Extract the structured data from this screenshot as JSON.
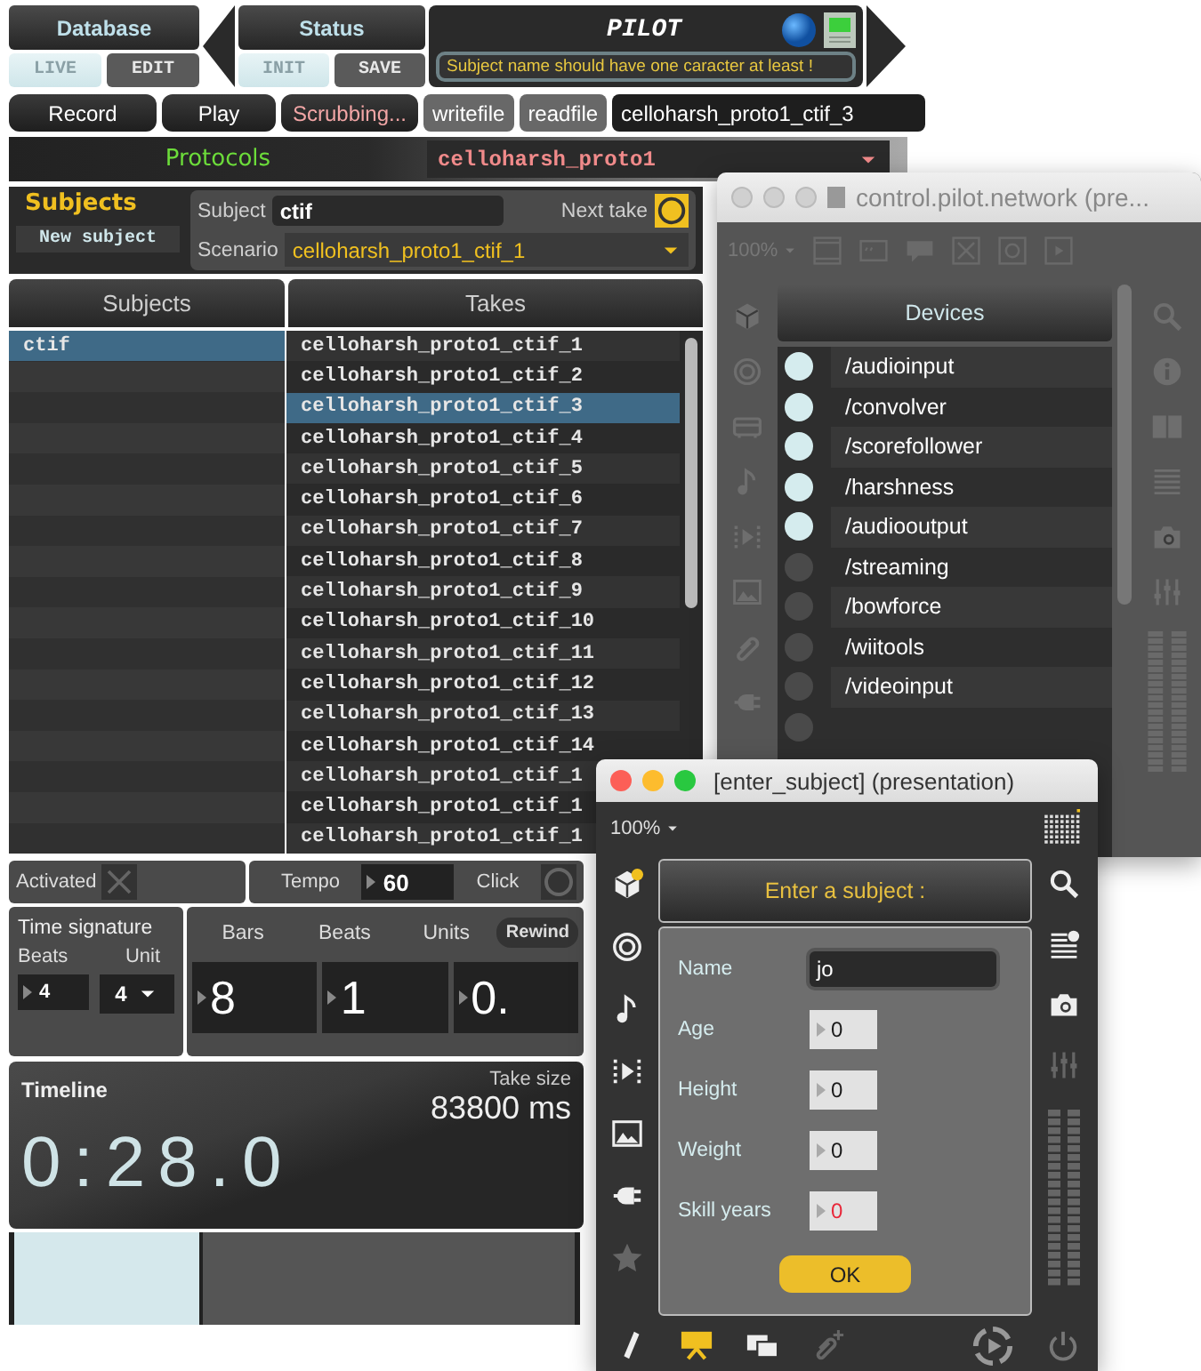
{
  "database": {
    "title": "Database",
    "buttons": [
      {
        "label": "LIVE",
        "selected": true
      },
      {
        "label": "EDIT",
        "selected": false
      }
    ]
  },
  "status": {
    "title": "Status",
    "buttons": [
      {
        "label": "INIT",
        "selected": true
      },
      {
        "label": "SAVE",
        "selected": false
      }
    ]
  },
  "pilot": {
    "title": "PILOT",
    "message": "Subject name should have one caracter at least !"
  },
  "transport": [
    {
      "label": "Record",
      "active": false
    },
    {
      "label": "Play",
      "active": false
    },
    {
      "label": "Scrubbing...",
      "active": true
    }
  ],
  "file": {
    "write": "writefile",
    "read": "readfile",
    "value": "celloharsh_proto1_ctif_3"
  },
  "protocols": {
    "label": "Protocols",
    "value": "celloharsh_proto1"
  },
  "subject_form": {
    "title": "Subjects",
    "new_button": "New subject",
    "subject_label": "Subject",
    "subject_value": "ctif",
    "next_take": "Next take",
    "scenario_label": "Scenario",
    "scenario_value": "celloharsh_proto1_ctif_1"
  },
  "subjects_table": {
    "column": "Subjects",
    "rows": [
      {
        "name": "ctif",
        "selected": true
      }
    ]
  },
  "takes_table": {
    "column": "Takes",
    "rows": [
      {
        "name": "celloharsh_proto1_ctif_1",
        "selected": false
      },
      {
        "name": "celloharsh_proto1_ctif_2",
        "selected": false
      },
      {
        "name": "celloharsh_proto1_ctif_3",
        "selected": true
      },
      {
        "name": "celloharsh_proto1_ctif_4",
        "selected": false
      },
      {
        "name": "celloharsh_proto1_ctif_5",
        "selected": false
      },
      {
        "name": "celloharsh_proto1_ctif_6",
        "selected": false
      },
      {
        "name": "celloharsh_proto1_ctif_7",
        "selected": false
      },
      {
        "name": "celloharsh_proto1_ctif_8",
        "selected": false
      },
      {
        "name": "celloharsh_proto1_ctif_9",
        "selected": false
      },
      {
        "name": "celloharsh_proto1_ctif_10",
        "selected": false
      },
      {
        "name": "celloharsh_proto1_ctif_11",
        "selected": false
      },
      {
        "name": "celloharsh_proto1_ctif_12",
        "selected": false
      },
      {
        "name": "celloharsh_proto1_ctif_13",
        "selected": false
      },
      {
        "name": "celloharsh_proto1_ctif_14",
        "selected": false
      },
      {
        "name": "celloharsh_proto1_ctif_1",
        "selected": false
      },
      {
        "name": "celloharsh_proto1_ctif_1",
        "selected": false
      },
      {
        "name": "celloharsh_proto1_ctif_1",
        "selected": false
      }
    ]
  },
  "activation": {
    "label": "Activated"
  },
  "tempo": {
    "label": "Tempo",
    "value": "60",
    "click_label": "Click"
  },
  "time_signature": {
    "title": "Time signature",
    "beats_label": "Beats",
    "unit_label": "Unit",
    "beats": "4",
    "unit": "4"
  },
  "position": {
    "columns": [
      "Bars",
      "Beats",
      "Units"
    ],
    "values": [
      "8",
      "1",
      "0."
    ],
    "rewind": "Rewind"
  },
  "timeline": {
    "title": "Timeline",
    "take_size_label": "Take size",
    "take_size": "83800 ms",
    "time": "0:28.0"
  },
  "progress": {
    "level": 0.33
  },
  "control_window": {
    "title": "control.pilot.network (pre...",
    "zoom": "100%",
    "devices_header": "Devices",
    "devices": [
      {
        "name": "/audioinput",
        "on": true
      },
      {
        "name": "/convolver",
        "on": true
      },
      {
        "name": "/scorefollower",
        "on": true
      },
      {
        "name": "/harshness",
        "on": true
      },
      {
        "name": "/audiooutput",
        "on": true
      },
      {
        "name": "/streaming",
        "on": false
      },
      {
        "name": "/bowforce",
        "on": false
      },
      {
        "name": "/wiitools",
        "on": false
      },
      {
        "name": "/videoinput",
        "on": false
      },
      {
        "on": false
      }
    ]
  },
  "enter_window": {
    "title": "[enter_subject] (presentation)",
    "zoom": "100%",
    "header": "Enter a subject :",
    "fields": [
      {
        "label": "Name",
        "value": "jo",
        "kind": "text",
        "invalid": false
      },
      {
        "label": "Age",
        "value": "0",
        "kind": "number",
        "invalid": false
      },
      {
        "label": "Height",
        "value": "0",
        "kind": "number",
        "invalid": false
      },
      {
        "label": "Weight",
        "value": "0",
        "kind": "number",
        "invalid": false
      },
      {
        "label": "Skill years",
        "value": "0",
        "kind": "number",
        "invalid": true
      }
    ],
    "ok": "OK"
  }
}
